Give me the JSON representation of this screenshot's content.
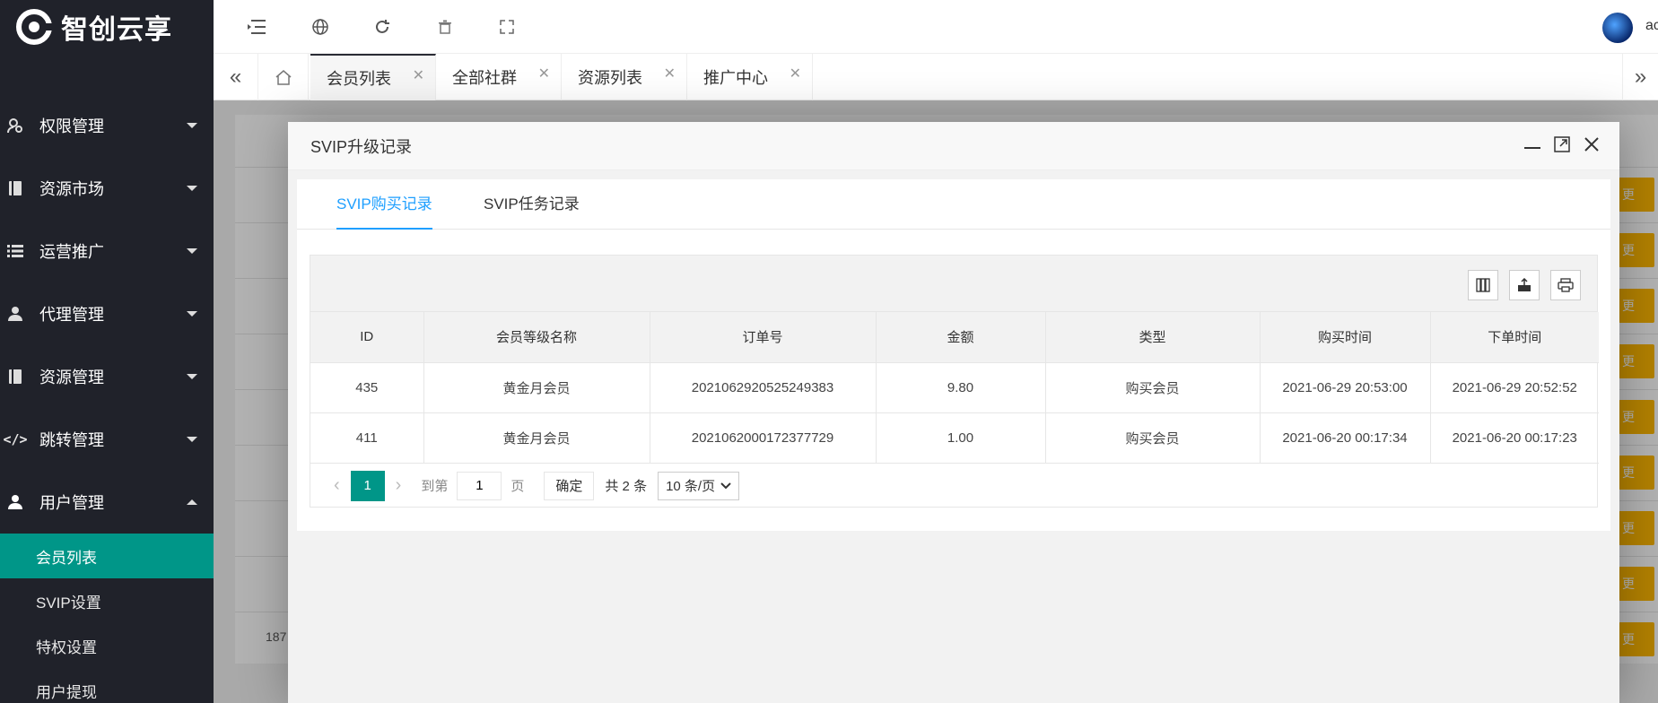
{
  "brand": {
    "name": "智创云享"
  },
  "sidebar": {
    "items": [
      {
        "label": "权限管理",
        "icon": "users-key-icon"
      },
      {
        "label": "资源市场",
        "icon": "book-icon"
      },
      {
        "label": "运营推广",
        "icon": "list-icon"
      },
      {
        "label": "代理管理",
        "icon": "agent-icon"
      },
      {
        "label": "资源管理",
        "icon": "book-icon"
      },
      {
        "label": "跳转管理",
        "icon": "code-icon"
      },
      {
        "label": "用户管理",
        "icon": "user-icon"
      }
    ],
    "sub_items": [
      {
        "label": "会员列表",
        "active": true
      },
      {
        "label": "SVIP设置"
      },
      {
        "label": "特权设置"
      },
      {
        "label": "用户提现"
      }
    ]
  },
  "header": {
    "icons": [
      "menu-fold-icon",
      "globe-icon",
      "refresh-icon",
      "trash-icon",
      "fullscreen-icon"
    ],
    "user_name": "ac"
  },
  "tabs": [
    {
      "label": "会员列表",
      "active": true
    },
    {
      "label": "全部社群"
    },
    {
      "label": "资源列表"
    },
    {
      "label": "推广中心"
    }
  ],
  "background": {
    "footer_number": "187",
    "button_label": "更"
  },
  "modal": {
    "title": "SVIP升级记录",
    "tabs": [
      {
        "label": "SVIP购买记录",
        "active": true
      },
      {
        "label": "SVIP任务记录"
      }
    ],
    "columns": [
      "ID",
      "会员等级名称",
      "订单号",
      "金额",
      "类型",
      "购买时间",
      "下单时间"
    ],
    "rows": [
      [
        "435",
        "黄金月会员",
        "2021062920525249383",
        "9.80",
        "购买会员",
        "2021-06-29 20:53:00",
        "2021-06-29 20:52:52"
      ],
      [
        "411",
        "黄金月会员",
        "2021062000172377729",
        "1.00",
        "购买会员",
        "2021-06-20 00:17:34",
        "2021-06-20 00:17:23"
      ]
    ],
    "pager": {
      "current_page": "1",
      "goto_label": "到第",
      "goto_value": "1",
      "page_unit": "页",
      "confirm_label": "确定",
      "total_label": "共 2 条",
      "page_size": "10 条/页"
    }
  },
  "colors": {
    "sidebar_bg": "#20222a",
    "active_green": "#009688",
    "tab_blue": "#1e9fff",
    "warn_yellow": "#ffb800"
  }
}
